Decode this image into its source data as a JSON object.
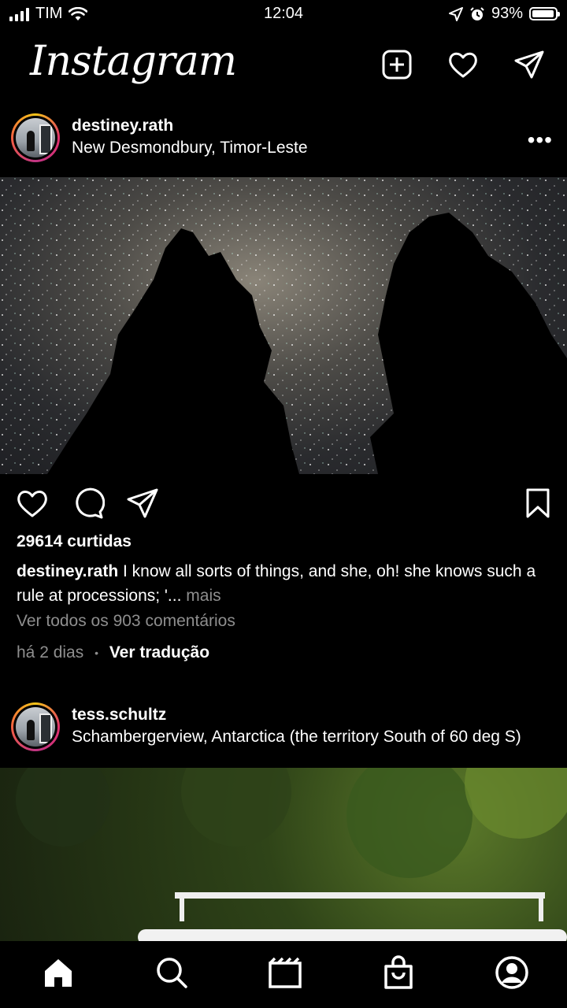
{
  "status_bar": {
    "carrier": "TIM",
    "time": "12:04",
    "battery": "93%"
  },
  "header": {
    "logo": "Instagram",
    "icons": [
      "new-post-icon",
      "heart-icon",
      "direct-send-icon"
    ]
  },
  "posts": [
    {
      "username": "destiney.rath",
      "location": "New Desmondbury, Timor-Leste",
      "likes": "29614 curtidas",
      "caption_user": "destiney.rath",
      "caption_text": "I know all sorts of things, and she, oh! she knows such a rule at processions; '...",
      "caption_more": "mais",
      "comments_link": "Ver todos os 903 comentários",
      "time_ago": "há 2 dias",
      "dot": "•",
      "translate": "Ver tradução"
    },
    {
      "username": "tess.schultz",
      "location": "Schambergerview, Antarctica (the territory South of 60 deg S)"
    }
  ],
  "bottom_nav": [
    "home-icon",
    "search-icon",
    "reels-icon",
    "shop-icon",
    "profile-icon"
  ]
}
